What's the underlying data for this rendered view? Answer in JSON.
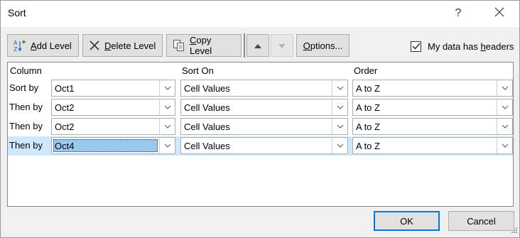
{
  "dialog": {
    "title": "Sort",
    "help_label": "?",
    "close_icon": "close-icon"
  },
  "toolbar": {
    "add_level": {
      "prefix": "",
      "accel": "A",
      "rest": "dd Level",
      "icon": "add-level-icon"
    },
    "delete_level": {
      "accel": "D",
      "rest": "elete Level",
      "icon": "delete-icon"
    },
    "copy_level": {
      "accel": "C",
      "rest": "opy Level",
      "icon": "copy-icon"
    },
    "move_up_icon": "arrow-up-icon",
    "move_down_icon": "arrow-down-icon",
    "options": {
      "accel": "O",
      "rest": "ptions..."
    },
    "headers_checkbox": {
      "checked": true,
      "prefix": "My data has ",
      "accel": "h",
      "rest": "eaders"
    }
  },
  "grid": {
    "headers": {
      "column": "Column",
      "sort_on": "Sort On",
      "order": "Order"
    },
    "rows": [
      {
        "label": "Sort by",
        "column": "Oct1",
        "sort_on": "Cell Values",
        "order": "A to Z",
        "selected": false
      },
      {
        "label": "Then by",
        "column": "Oct2",
        "sort_on": "Cell Values",
        "order": "A to Z",
        "selected": false
      },
      {
        "label": "Then by",
        "column": "Oct2",
        "sort_on": "Cell Values",
        "order": "A to Z",
        "selected": false
      },
      {
        "label": "Then by",
        "column": "Oct4",
        "sort_on": "Cell Values",
        "order": "A to Z",
        "selected": true
      }
    ]
  },
  "footer": {
    "ok_label": "OK",
    "cancel_label": "Cancel"
  },
  "colors": {
    "selected_row": "#cde8ff",
    "highlight": "#99c9ef",
    "accent": "#0078d7"
  }
}
